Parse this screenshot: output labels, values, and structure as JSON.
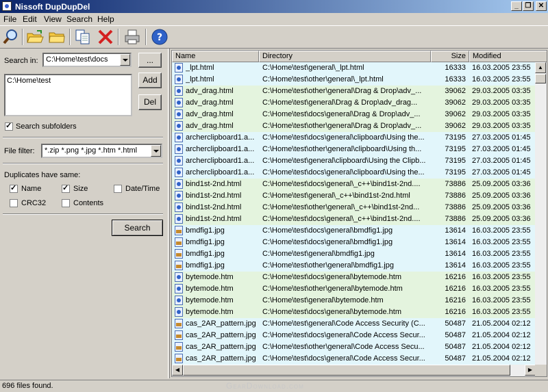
{
  "window": {
    "title": "Nissoft DupDupDel"
  },
  "menu": [
    "File",
    "Edit",
    "View",
    "Search",
    "Help"
  ],
  "left": {
    "search_in_label": "Search in:",
    "search_in_value": "C:\\Home\\test\\docs",
    "browse_label": "...",
    "folders": [
      "C:\\Home\\test"
    ],
    "add_label": "Add",
    "del_label": "Del",
    "subfolders_label": "Search subfolders",
    "subfolders_checked": true,
    "filter_label": "File filter:",
    "filter_value": "*.zip *.png *.jpg *.htm *.html",
    "dup_label": "Duplicates have same:",
    "criteria": {
      "name": {
        "label": "Name",
        "checked": true
      },
      "size": {
        "label": "Size",
        "checked": true
      },
      "datetime": {
        "label": "Date/Time",
        "checked": false
      },
      "crc32": {
        "label": "CRC32",
        "checked": false
      },
      "contents": {
        "label": "Contents",
        "checked": false
      }
    },
    "search_label": "Search"
  },
  "grid": {
    "columns": [
      "Name",
      "Directory",
      "Size",
      "Modified"
    ],
    "rows": [
      {
        "name": "_lpt.html",
        "dir": "C:\\Home\\test\\general\\_lpt.html",
        "size": "16333",
        "modified": "16.03.2005 23:55",
        "type": "html",
        "color": "cyan"
      },
      {
        "name": "_lpt.html",
        "dir": "C:\\Home\\test\\other\\general\\_lpt.html",
        "size": "16333",
        "modified": "16.03.2005 23:55",
        "type": "html",
        "color": "cyan"
      },
      {
        "name": "adv_drag.html",
        "dir": "C:\\Home\\test\\other\\general\\Drag & Drop\\adv_...",
        "size": "39062",
        "modified": "29.03.2005 03:35",
        "type": "html",
        "color": "green"
      },
      {
        "name": "adv_drag.html",
        "dir": "C:\\Home\\test\\general\\Drag & Drop\\adv_drag...",
        "size": "39062",
        "modified": "29.03.2005 03:35",
        "type": "html",
        "color": "green"
      },
      {
        "name": "adv_drag.html",
        "dir": "C:\\Home\\test\\docs\\general\\Drag & Drop\\adv_...",
        "size": "39062",
        "modified": "29.03.2005 03:35",
        "type": "html",
        "color": "green"
      },
      {
        "name": "adv_drag.html",
        "dir": "C:\\Home\\test\\other\\general\\Drag & Drop\\adv_...",
        "size": "39062",
        "modified": "29.03.2005 03:35",
        "type": "html",
        "color": "green"
      },
      {
        "name": "archerclipboard1.a...",
        "dir": "C:\\Home\\test\\docs\\general\\clipboard\\Using the...",
        "size": "73195",
        "modified": "27.03.2005 01:45",
        "type": "html",
        "color": "cyan"
      },
      {
        "name": "archerclipboard1.a...",
        "dir": "C:\\Home\\test\\other\\general\\clipboard\\Using th...",
        "size": "73195",
        "modified": "27.03.2005 01:45",
        "type": "html",
        "color": "cyan"
      },
      {
        "name": "archerclipboard1.a...",
        "dir": "C:\\Home\\test\\general\\clipboard\\Using the Clipb...",
        "size": "73195",
        "modified": "27.03.2005 01:45",
        "type": "html",
        "color": "cyan"
      },
      {
        "name": "archerclipboard1.a...",
        "dir": "C:\\Home\\test\\docs\\general\\clipboard\\Using the...",
        "size": "73195",
        "modified": "27.03.2005 01:45",
        "type": "html",
        "color": "cyan"
      },
      {
        "name": "bind1st-2nd.html",
        "dir": "C:\\Home\\test\\docs\\general\\_c++\\bind1st-2nd....",
        "size": "73886",
        "modified": "25.09.2005 03:36",
        "type": "html",
        "color": "green"
      },
      {
        "name": "bind1st-2nd.html",
        "dir": "C:\\Home\\test\\general\\_c++\\bind1st-2nd.html",
        "size": "73886",
        "modified": "25.09.2005 03:36",
        "type": "html",
        "color": "green"
      },
      {
        "name": "bind1st-2nd.html",
        "dir": "C:\\Home\\test\\other\\general\\_c++\\bind1st-2nd...",
        "size": "73886",
        "modified": "25.09.2005 03:36",
        "type": "html",
        "color": "green"
      },
      {
        "name": "bind1st-2nd.html",
        "dir": "C:\\Home\\test\\docs\\general\\_c++\\bind1st-2nd....",
        "size": "73886",
        "modified": "25.09.2005 03:36",
        "type": "html",
        "color": "green"
      },
      {
        "name": "bmdfig1.jpg",
        "dir": "C:\\Home\\test\\docs\\general\\bmdfig1.jpg",
        "size": "13614",
        "modified": "16.03.2005 23:55",
        "type": "jpg",
        "color": "cyan"
      },
      {
        "name": "bmdfig1.jpg",
        "dir": "C:\\Home\\test\\docs\\general\\bmdfig1.jpg",
        "size": "13614",
        "modified": "16.03.2005 23:55",
        "type": "jpg",
        "color": "cyan"
      },
      {
        "name": "bmdfig1.jpg",
        "dir": "C:\\Home\\test\\general\\bmdfig1.jpg",
        "size": "13614",
        "modified": "16.03.2005 23:55",
        "type": "jpg",
        "color": "cyan"
      },
      {
        "name": "bmdfig1.jpg",
        "dir": "C:\\Home\\test\\other\\general\\bmdfig1.jpg",
        "size": "13614",
        "modified": "16.03.2005 23:55",
        "type": "jpg",
        "color": "cyan"
      },
      {
        "name": "bytemode.htm",
        "dir": "C:\\Home\\test\\docs\\general\\bytemode.htm",
        "size": "16216",
        "modified": "16.03.2005 23:55",
        "type": "html",
        "color": "green"
      },
      {
        "name": "bytemode.htm",
        "dir": "C:\\Home\\test\\other\\general\\bytemode.htm",
        "size": "16216",
        "modified": "16.03.2005 23:55",
        "type": "html",
        "color": "green"
      },
      {
        "name": "bytemode.htm",
        "dir": "C:\\Home\\test\\general\\bytemode.htm",
        "size": "16216",
        "modified": "16.03.2005 23:55",
        "type": "html",
        "color": "green"
      },
      {
        "name": "bytemode.htm",
        "dir": "C:\\Home\\test\\docs\\general\\bytemode.htm",
        "size": "16216",
        "modified": "16.03.2005 23:55",
        "type": "html",
        "color": "green"
      },
      {
        "name": "cas_2AR_pattern.jpg",
        "dir": "C:\\Home\\test\\general\\Code Access Security (C...",
        "size": "50487",
        "modified": "21.05.2004 02:12",
        "type": "jpg",
        "color": "cyan"
      },
      {
        "name": "cas_2AR_pattern.jpg",
        "dir": "C:\\Home\\test\\docs\\general\\Code Access Secur...",
        "size": "50487",
        "modified": "21.05.2004 02:12",
        "type": "jpg",
        "color": "cyan"
      },
      {
        "name": "cas_2AR_pattern.jpg",
        "dir": "C:\\Home\\test\\other\\general\\Code Access Secu...",
        "size": "50487",
        "modified": "21.05.2004 02:12",
        "type": "jpg",
        "color": "cyan"
      },
      {
        "name": "cas_2AR_pattern.jpg",
        "dir": "C:\\Home\\test\\docs\\general\\Code Access Secur...",
        "size": "50487",
        "modified": "21.05.2004 02:12",
        "type": "jpg",
        "color": "cyan"
      }
    ]
  },
  "status": {
    "text": "696 files found."
  },
  "watermark": "GearDownload.com",
  "icons": [
    "search-icon",
    "open-folder-icon",
    "folder-icon",
    "copy-icon",
    "delete-icon",
    "print-icon",
    "help-icon"
  ],
  "colors": {
    "row_cyan": "#e2f6fb",
    "row_green": "#e4f4de",
    "title_start": "#0a246a",
    "title_end": "#a6caf0"
  }
}
